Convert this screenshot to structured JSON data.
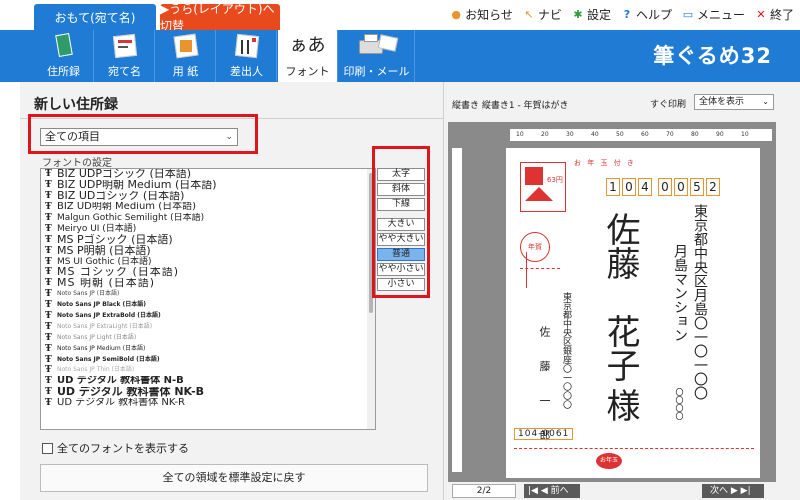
{
  "tabs": {
    "front": "おもて(宛て名)",
    "back": "▶うら(レイアウト)へ切替"
  },
  "top_menu": [
    {
      "icon": "bell-icon",
      "glyph": "🔔",
      "label": "お知らせ"
    },
    {
      "icon": "navi-icon",
      "glyph": "↖",
      "label": "ナビ"
    },
    {
      "icon": "gear-icon",
      "glyph": "✱",
      "label": "設定"
    },
    {
      "icon": "help-icon",
      "glyph": "?",
      "label": "ヘルプ"
    },
    {
      "icon": "menu-icon",
      "glyph": "▭",
      "label": "メニュー"
    },
    {
      "icon": "close-icon",
      "glyph": "✕",
      "label": "終了"
    }
  ],
  "ribbon": [
    {
      "label": "住所録"
    },
    {
      "label": "宛て名"
    },
    {
      "label": "用 紙"
    },
    {
      "label": "差出人"
    },
    {
      "label": "フォント",
      "active": true
    },
    {
      "label": "印刷・メール"
    }
  ],
  "logo": "筆ぐるめ32",
  "left": {
    "title": "新しい住所録",
    "select_value": "全ての項目",
    "fontset_label": "フォントの設定",
    "fonts": [
      "BIZ UDPゴシック (日本語)",
      "BIZ UDP明朝 Medium (日本語)",
      "BIZ UDゴシック (日本語)",
      "BIZ UD明朝 Medium (日本語)",
      "Malgun Gothic Semilight (日本語)",
      "Meiryo UI (日本語)",
      "MS Pゴシック (日本語)",
      "MS P明朝 (日本語)",
      "MS UI Gothic (日本語)",
      "MS ゴシック (日本語)",
      "MS 明朝 (日本語)",
      "Noto Sans JP (日本語)",
      "Noto Sans JP Black (日本語)",
      "Noto Sans JP ExtraBold (日本語)",
      "Noto Sans JP ExtraLight (日本語)",
      "Noto Sans JP Light (日本語)",
      "Noto Sans JP Medium (日本語)",
      "Noto Sans JP SemiBold (日本語)",
      "Noto Sans JP Thin (日本語)",
      "UD デジタル 教科書体 N-B",
      "UD デジタル 教科書体 NK-B",
      "UD デジタル 教科書体 NK-R"
    ],
    "style_buttons": [
      "太字",
      "斜体",
      "下線"
    ],
    "size_buttons": [
      "大きい",
      "やや大きい",
      "普通",
      "やや小さい",
      "小さい"
    ],
    "selected_size": "普通",
    "show_all_fonts": "全てのフォントを表示する",
    "reset_button": "全ての領域を標準設定に戻す"
  },
  "right": {
    "preview_title": "縦書き 縦書き1 - 年賀はがき",
    "print_label": "すぐ印刷",
    "zoom": "全体を表示",
    "ruler_marks": [
      "10",
      "20",
      "30",
      "40",
      "50",
      "60",
      "70",
      "80",
      "90",
      "10"
    ],
    "card": {
      "header": "お 年 玉 付 き",
      "postal_code": [
        "1",
        "0",
        "4",
        "0",
        "0",
        "5",
        "2"
      ],
      "address": "東京都中央区月島〇一〇一〇〇",
      "building": "月島マンション",
      "room": "〇〇〇〇",
      "recipient_family": "佐藤",
      "recipient_given": "花子",
      "honorific": "様",
      "sender_address": "東京都中央区銀座〇一〇〇〇",
      "sender_name": "佐 藤 一 郎",
      "sender_postal": "104-0061",
      "stamp_text": "年賀",
      "price_text": "63円",
      "lottery": "お年玉"
    },
    "page": "2/2",
    "prev": "前へ",
    "next": "次へ"
  },
  "colors": {
    "ribbon": "#1f7bd4",
    "back_tab": "#e8491d",
    "highlight": "#e0151b",
    "postal": "#e8952e"
  }
}
